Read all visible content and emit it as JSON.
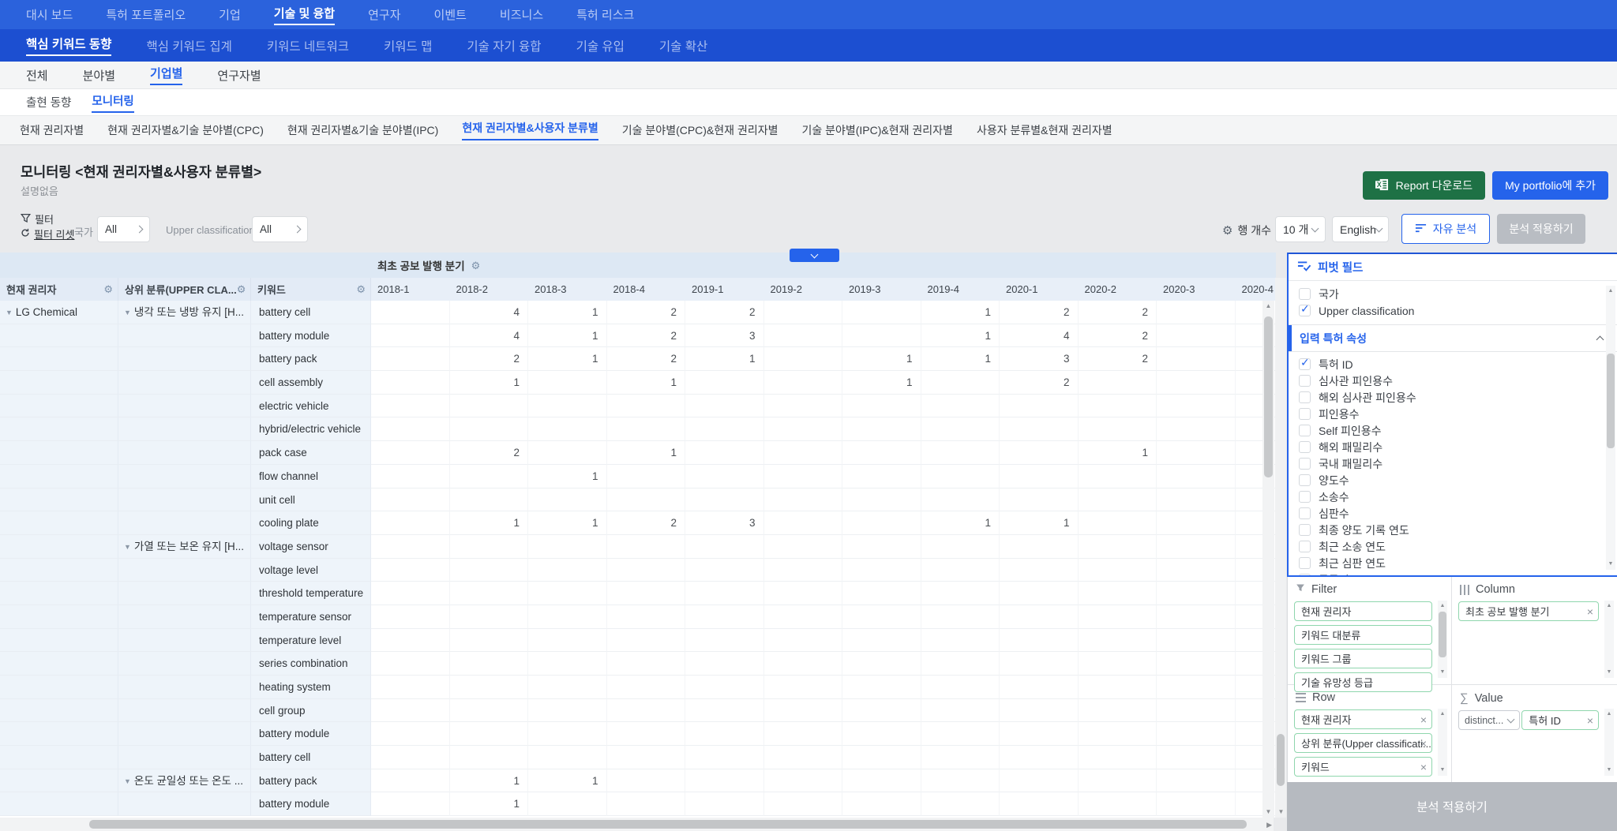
{
  "nav_main": {
    "items": [
      {
        "label": "대시 보드"
      },
      {
        "label": "특허 포트폴리오"
      },
      {
        "label": "기업"
      },
      {
        "label": "기술 및 융합",
        "active": true
      },
      {
        "label": "연구자"
      },
      {
        "label": "이벤트"
      },
      {
        "label": "비즈니스"
      },
      {
        "label": "특허 리스크"
      }
    ]
  },
  "nav_sub": {
    "items": [
      {
        "label": "핵심 키워드 동향",
        "active": true
      },
      {
        "label": "핵심 키워드 집계"
      },
      {
        "label": "키워드 네트워크"
      },
      {
        "label": "키워드 맵"
      },
      {
        "label": "기술 자기 융합"
      },
      {
        "label": "기술 유입"
      },
      {
        "label": "기술 확산"
      }
    ]
  },
  "nav_scope": {
    "items": [
      {
        "label": "전체"
      },
      {
        "label": "분야별"
      },
      {
        "label": "기업별",
        "active": true
      },
      {
        "label": "연구자별"
      }
    ]
  },
  "nav_view": {
    "items": [
      {
        "label": "출현 동향"
      },
      {
        "label": "모니터링",
        "active": true
      }
    ]
  },
  "nav_monitor": {
    "items": [
      {
        "label": "현재 권리자별"
      },
      {
        "label": "현재 권리자별&기술 분야별(CPC)"
      },
      {
        "label": "현재 권리자별&기술 분야별(IPC)"
      },
      {
        "label": "현재 권리자별&사용자 분류별",
        "active": true
      },
      {
        "label": "기술 분야별(CPC)&현재 권리자별"
      },
      {
        "label": "기술 분야별(IPC)&현재 권리자별"
      },
      {
        "label": "사용자 분류별&현재 권리자별"
      }
    ]
  },
  "header": {
    "title": "모니터링 <현재 권리자별&사용자 분류별>",
    "subtitle": "설명없음",
    "report_button": "Report 다운로드",
    "portfolio_button": "My portfolio에 추가"
  },
  "filter_bar": {
    "filter_label": "필터",
    "reset_label": "필터 리셋",
    "country_label": "국가",
    "country_value": "All",
    "upper_label": "Upper classification",
    "upper_value": "All",
    "row_count_label": "행 개수",
    "row_count_value": "10 개",
    "language_value": "English",
    "free_analysis": "자유 분석",
    "apply": "분석 적용하기"
  },
  "table": {
    "span_header": "최초 공보 발행 분기",
    "columns": [
      "현재 권리자",
      "상위 분류(UPPER CLA...",
      "키워드"
    ],
    "quarters": [
      "2018-1",
      "2018-2",
      "2018-3",
      "2018-4",
      "2019-1",
      "2019-2",
      "2019-3",
      "2019-4",
      "2020-1",
      "2020-2",
      "2020-3",
      "2020-4"
    ],
    "rows": [
      {
        "owner": "LG Chemical",
        "group": "냉각 또는 냉방 유지 [H...",
        "keyword": "battery cell",
        "values": [
          "",
          "4",
          "1",
          "2",
          "2",
          "",
          "",
          "1",
          "2",
          "2",
          "",
          ""
        ]
      },
      {
        "owner": "",
        "group": "",
        "keyword": "battery module",
        "values": [
          "",
          "4",
          "1",
          "2",
          "3",
          "",
          "",
          "1",
          "4",
          "2",
          "",
          ""
        ]
      },
      {
        "owner": "",
        "group": "",
        "keyword": "battery pack",
        "values": [
          "",
          "2",
          "1",
          "2",
          "1",
          "",
          "1",
          "1",
          "3",
          "2",
          "",
          ""
        ]
      },
      {
        "owner": "",
        "group": "",
        "keyword": "cell assembly",
        "values": [
          "",
          "1",
          "",
          "1",
          "",
          "",
          "1",
          "",
          "2",
          "",
          "",
          ""
        ]
      },
      {
        "owner": "",
        "group": "",
        "keyword": "electric vehicle",
        "values": [
          "",
          "",
          "",
          "",
          "",
          "",
          "",
          "",
          "",
          "",
          "",
          ""
        ]
      },
      {
        "owner": "",
        "group": "",
        "keyword": "hybrid/electric vehicle",
        "values": [
          "",
          "",
          "",
          "",
          "",
          "",
          "",
          "",
          "",
          "",
          "",
          ""
        ]
      },
      {
        "owner": "",
        "group": "",
        "keyword": "pack case",
        "values": [
          "",
          "2",
          "",
          "1",
          "",
          "",
          "",
          "",
          "",
          "1",
          "",
          ""
        ]
      },
      {
        "owner": "",
        "group": "",
        "keyword": "flow channel",
        "values": [
          "",
          "",
          "1",
          "",
          "",
          "",
          "",
          "",
          "",
          "",
          "",
          ""
        ]
      },
      {
        "owner": "",
        "group": "",
        "keyword": "unit cell",
        "values": [
          "",
          "",
          "",
          "",
          "",
          "",
          "",
          "",
          "",
          "",
          "",
          ""
        ]
      },
      {
        "owner": "",
        "group": "",
        "keyword": "cooling plate",
        "values": [
          "",
          "1",
          "1",
          "2",
          "3",
          "",
          "",
          "1",
          "1",
          "",
          "",
          ""
        ]
      },
      {
        "owner": "",
        "group": "가열 또는 보온 유지 [H...",
        "keyword": "voltage sensor",
        "values": [
          "",
          "",
          "",
          "",
          "",
          "",
          "",
          "",
          "",
          "",
          "",
          ""
        ]
      },
      {
        "owner": "",
        "group": "",
        "keyword": "voltage level",
        "values": [
          "",
          "",
          "",
          "",
          "",
          "",
          "",
          "",
          "",
          "",
          "",
          ""
        ]
      },
      {
        "owner": "",
        "group": "",
        "keyword": "threshold temperature",
        "values": [
          "",
          "",
          "",
          "",
          "",
          "",
          "",
          "",
          "",
          "",
          "",
          ""
        ]
      },
      {
        "owner": "",
        "group": "",
        "keyword": "temperature sensor",
        "values": [
          "",
          "",
          "",
          "",
          "",
          "",
          "",
          "",
          "",
          "",
          "",
          ""
        ]
      },
      {
        "owner": "",
        "group": "",
        "keyword": "temperature level",
        "values": [
          "",
          "",
          "",
          "",
          "",
          "",
          "",
          "",
          "",
          "",
          "",
          ""
        ]
      },
      {
        "owner": "",
        "group": "",
        "keyword": "series combination",
        "values": [
          "",
          "",
          "",
          "",
          "",
          "",
          "",
          "",
          "",
          "",
          "",
          ""
        ]
      },
      {
        "owner": "",
        "group": "",
        "keyword": "heating system",
        "values": [
          "",
          "",
          "",
          "",
          "",
          "",
          "",
          "",
          "",
          "",
          "",
          ""
        ]
      },
      {
        "owner": "",
        "group": "",
        "keyword": "cell group",
        "values": [
          "",
          "",
          "",
          "",
          "",
          "",
          "",
          "",
          "",
          "",
          "",
          ""
        ]
      },
      {
        "owner": "",
        "group": "",
        "keyword": "battery module",
        "values": [
          "",
          "",
          "",
          "",
          "",
          "",
          "",
          "",
          "",
          "",
          "",
          ""
        ]
      },
      {
        "owner": "",
        "group": "",
        "keyword": "battery cell",
        "values": [
          "",
          "",
          "",
          "",
          "",
          "",
          "",
          "",
          "",
          "",
          "",
          ""
        ]
      },
      {
        "owner": "",
        "group": "온도 균일성 또는 온도 ...",
        "keyword": "battery pack",
        "values": [
          "",
          "1",
          "1",
          "",
          "",
          "",
          "",
          "",
          "",
          "",
          "",
          ""
        ]
      },
      {
        "owner": "",
        "group": "",
        "keyword": "battery module",
        "values": [
          "",
          "1",
          "",
          "",
          "",
          "",
          "",
          "",
          "",
          "",
          "",
          ""
        ]
      }
    ]
  },
  "pivot": {
    "title": "피벗 필드",
    "fields": [
      {
        "label": "국가"
      },
      {
        "label": "Upper classification",
        "checked": true
      }
    ],
    "section": "입력 특허 속성",
    "attributes": [
      {
        "label": "특허 ID",
        "checked": true
      },
      {
        "label": "심사관 피인용수"
      },
      {
        "label": "해외 심사관 피인용수"
      },
      {
        "label": "피인용수"
      },
      {
        "label": "Self 피인용수"
      },
      {
        "label": "해외 패밀리수"
      },
      {
        "label": "국내 패밀리수"
      },
      {
        "label": "양도수"
      },
      {
        "label": "소송수"
      },
      {
        "label": "심판수"
      },
      {
        "label": "최종 양도 기록 연도"
      },
      {
        "label": "최근 소송 연도"
      },
      {
        "label": "최근 심판 연도"
      },
      {
        "label": "등록연도"
      }
    ],
    "filter_zone": {
      "label": "Filter",
      "chips": [
        {
          "label": "현재 권리자"
        },
        {
          "label": "키워드 대분류"
        },
        {
          "label": "키워드 그룹"
        },
        {
          "label": "기술 유망성 등급"
        }
      ]
    },
    "column_zone": {
      "label": "Column",
      "chips": [
        {
          "label": "최초 공보 발행 분기"
        }
      ]
    },
    "row_zone": {
      "label": "Row",
      "chips": [
        {
          "label": "현재 권리자"
        },
        {
          "label": "상위 분류(Upper classificati..."
        },
        {
          "label": "키워드"
        }
      ]
    },
    "value_zone": {
      "label": "Value",
      "agg": "distinct...",
      "chips": [
        {
          "label": "특허 ID"
        }
      ]
    },
    "apply_button": "분석 적용하기"
  }
}
